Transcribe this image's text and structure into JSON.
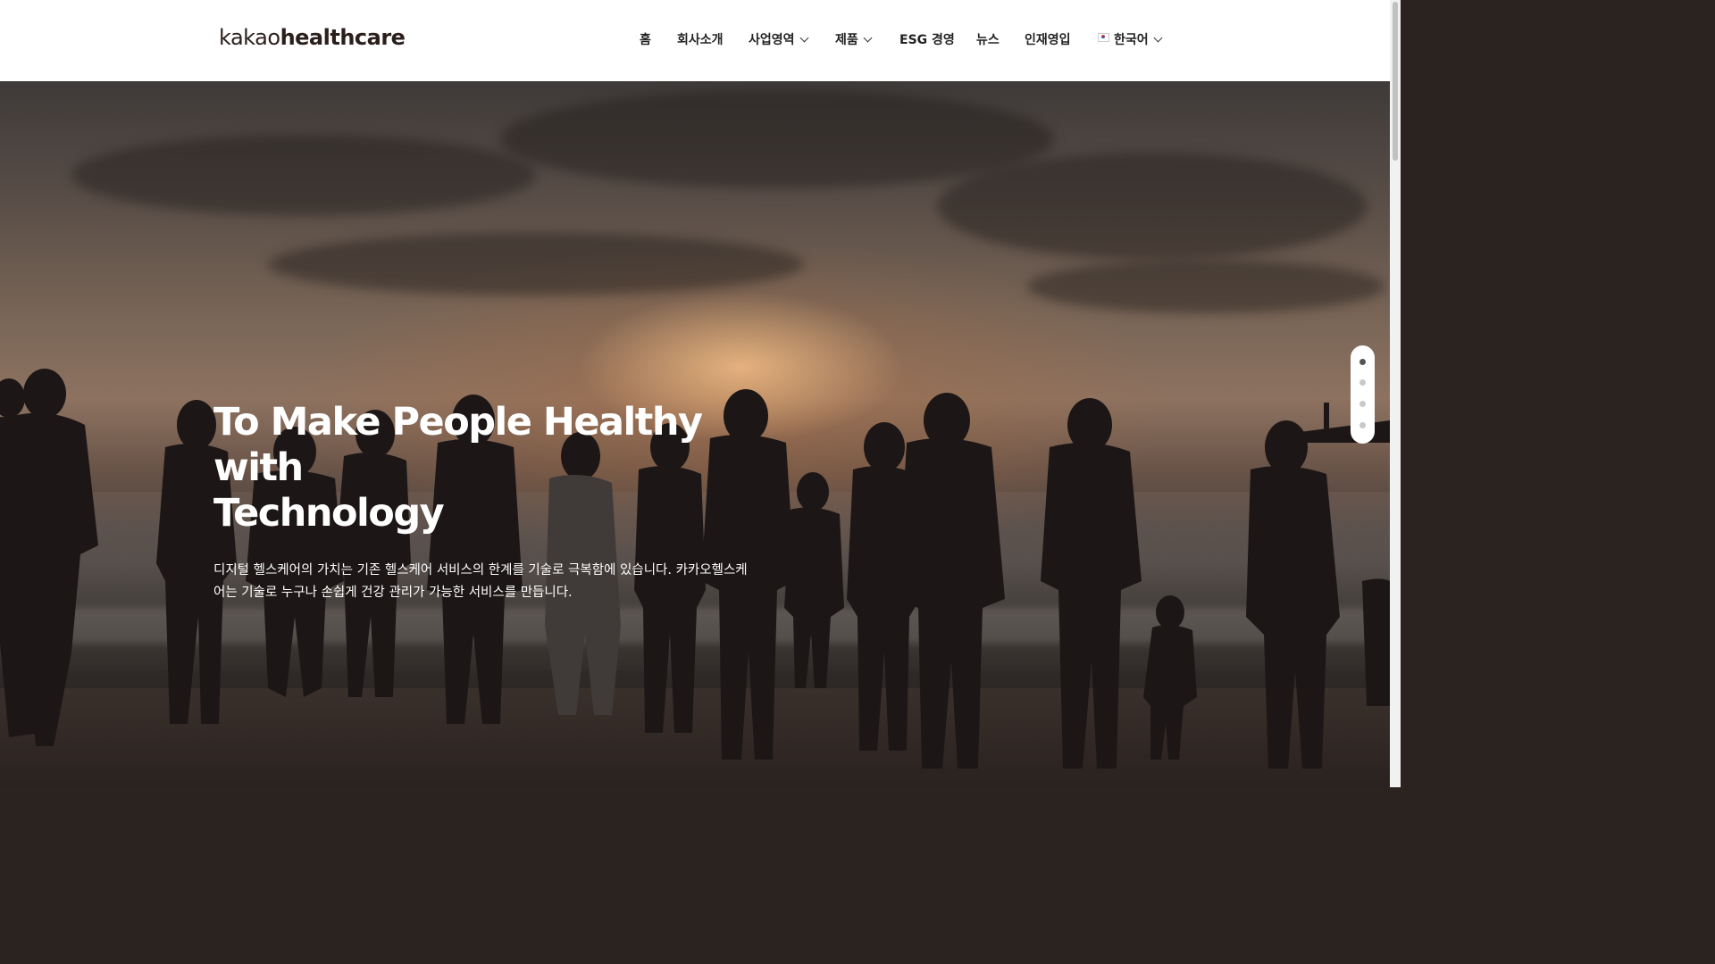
{
  "header": {
    "logo_part1": "kakao",
    "logo_part2": "healthcare"
  },
  "nav": {
    "items": [
      {
        "label": "홈",
        "has_dropdown": false
      },
      {
        "label": "회사소개",
        "has_dropdown": false
      },
      {
        "label": "사업영역",
        "has_dropdown": true
      },
      {
        "label": "제품",
        "has_dropdown": true
      },
      {
        "label": "ESG 경영",
        "has_dropdown": false
      },
      {
        "label": "뉴스",
        "has_dropdown": false
      },
      {
        "label": "인재영입",
        "has_dropdown": false
      }
    ],
    "language": {
      "label": "한국어",
      "icon": "korea-flag-icon"
    }
  },
  "hero": {
    "title_line1": "To Make People Healthy with",
    "title_line2": "Technology",
    "description_line1": "디지털 헬스케어의 가치는 기존 헬스케어 서비스의 한계를 기술로 극복함에 있습니다. 카카오헬스케",
    "description_line2": "어는 기술로 누구나 손쉽게 건강 관리가 가능한 서비스를 만듭니다.",
    "background": "sunset beach with family silhouettes"
  },
  "slider": {
    "total": 4,
    "active_index": 0
  },
  "colors": {
    "header_bg": "#ffffff",
    "text_dark": "#222222",
    "hero_text": "#ffffff",
    "dot_active": "#555555",
    "dot_inactive": "#c9c9c9"
  }
}
